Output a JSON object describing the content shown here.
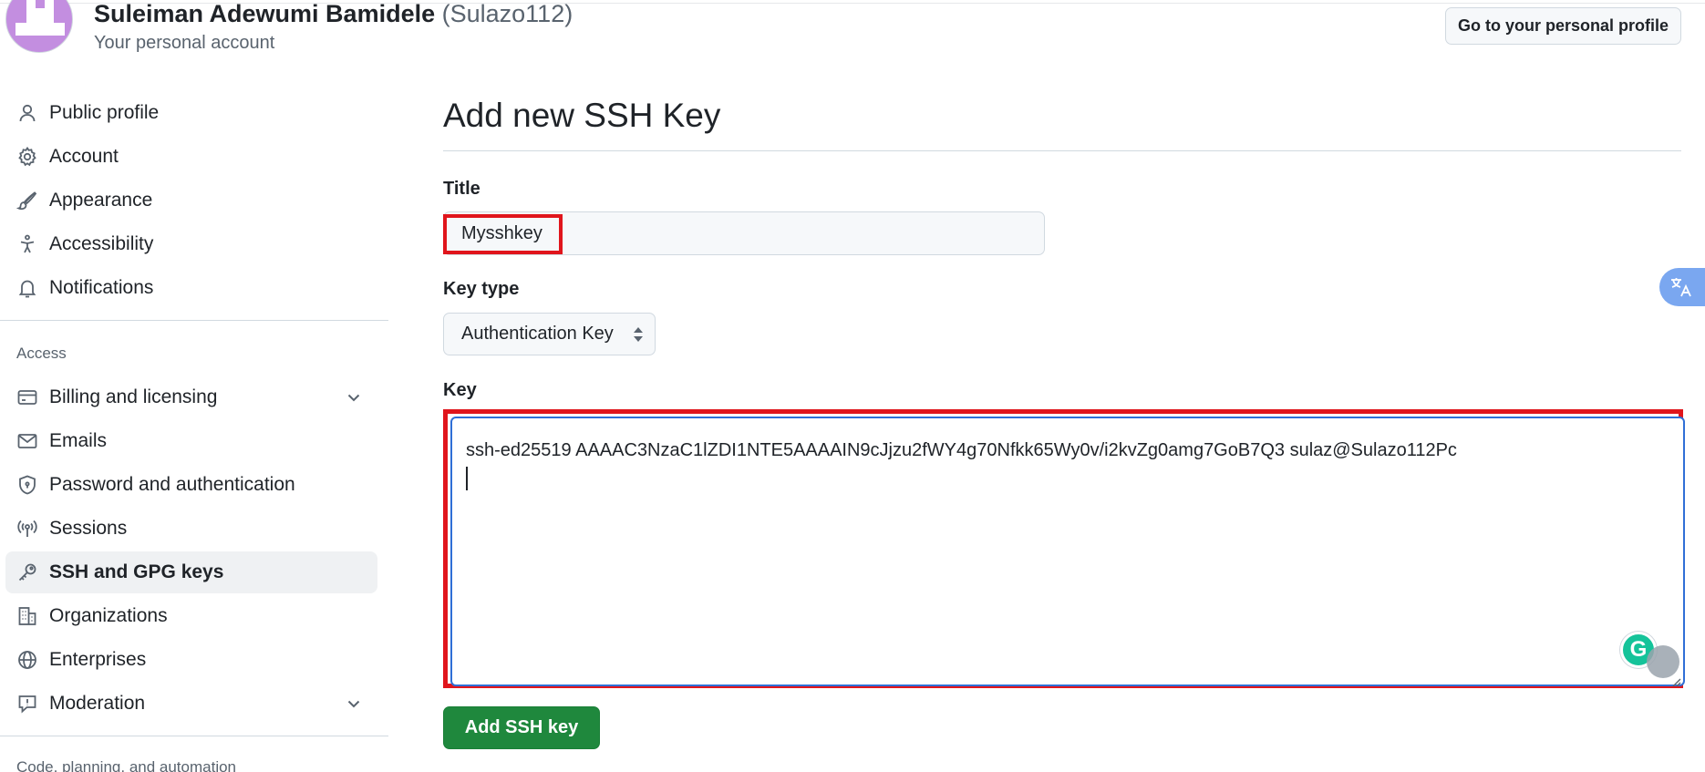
{
  "header": {
    "user_name": "Suleiman Adewumi Bamidele",
    "user_handle": "(Sulazo112)",
    "subtitle": "Your personal account",
    "profile_button": "Go to your personal profile"
  },
  "sidebar": {
    "items": [
      {
        "label": "Public profile",
        "icon": "person-icon"
      },
      {
        "label": "Account",
        "icon": "gear-icon"
      },
      {
        "label": "Appearance",
        "icon": "paintbrush-icon"
      },
      {
        "label": "Accessibility",
        "icon": "accessibility-icon"
      },
      {
        "label": "Notifications",
        "icon": "bell-icon"
      }
    ],
    "section_access": "Access",
    "access_items": [
      {
        "label": "Billing and licensing",
        "icon": "credit-card-icon",
        "expandable": true
      },
      {
        "label": "Emails",
        "icon": "mail-icon"
      },
      {
        "label": "Password and authentication",
        "icon": "shield-icon"
      },
      {
        "label": "Sessions",
        "icon": "broadcast-icon"
      },
      {
        "label": "SSH and GPG keys",
        "icon": "key-icon",
        "active": true
      },
      {
        "label": "Organizations",
        "icon": "organization-icon"
      },
      {
        "label": "Enterprises",
        "icon": "globe-icon"
      },
      {
        "label": "Moderation",
        "icon": "report-icon",
        "expandable": true
      }
    ],
    "section_code": "Code, planning, and automation"
  },
  "main": {
    "title": "Add new SSH Key",
    "title_label": "Title",
    "title_value": "Mysshkey",
    "key_type_label": "Key type",
    "key_type_value": "Authentication Key",
    "key_label": "Key",
    "key_value": "ssh-ed25519 AAAAC3NzaC1lZDI1NTE5AAAAIN9cJjzu2fWY4g70Nfkk65Wy0v/i2kvZg0amg7GoB7Q3 sulaz@Sulazo112Pc",
    "submit_button": "Add SSH key"
  },
  "colors": {
    "highlight": "#e0151c",
    "primary_button": "#1f883d",
    "active_nav": "#eff1f3",
    "focus_border": "#2f6fd6"
  }
}
